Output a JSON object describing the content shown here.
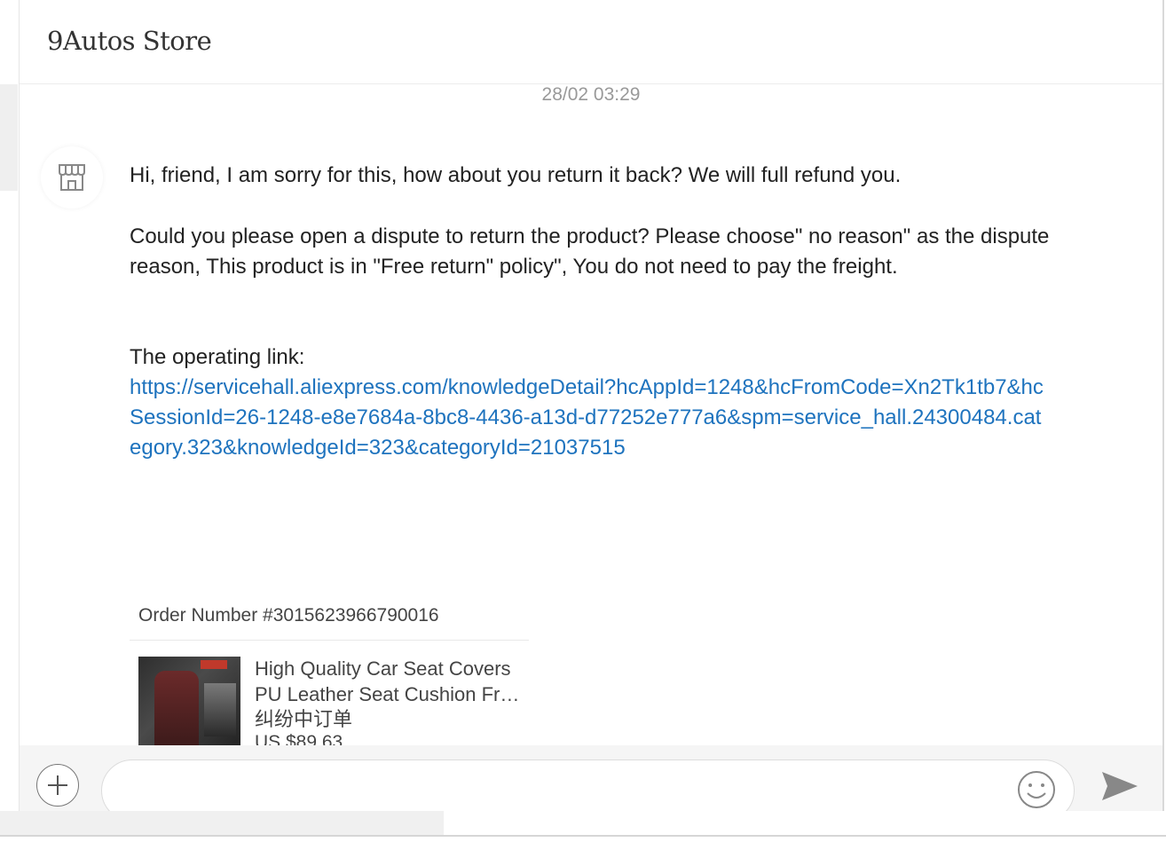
{
  "header": {
    "title": "9Autos Store"
  },
  "chat": {
    "timestamp": "28/02 03:29",
    "message": {
      "avatar_icon": "store-icon",
      "para1": "Hi, friend, I am sorry for this, how about you return it back? We will full refund you.",
      "para2": "Could you please open a dispute to return the product? Please choose\" no reason\" as the dispute reason, This product is in \"Free return\" policy\", You do not need to pay the freight.",
      "link_intro": "The operating link:",
      "link": "https://servicehall.aliexpress.com/knowledgeDetail?hcAppId=1248&hcFromCode=Xn2Tk1tb7&hcSessionId=26-1248-e8e7684a-8bc8-4436-a13d-d77252e777a6&spm=service_hall.24300484.category.323&knowledgeId=323&categoryId=21037515"
    },
    "order": {
      "order_number": "Order Number #3015623966790016",
      "product_title_line1": "High Quality Car Seat Covers",
      "product_title_line2": "PU Leather Seat Cushion Fr…",
      "status_tag": "纠纷中订单",
      "price": "US $89.63"
    }
  },
  "input": {
    "placeholder": "",
    "plus_icon": "plus-icon",
    "emoji_icon": "emoji-icon",
    "send_icon": "send-icon"
  },
  "colors": {
    "link": "#1e73be",
    "timestamp": "#999999",
    "text": "#222222"
  }
}
